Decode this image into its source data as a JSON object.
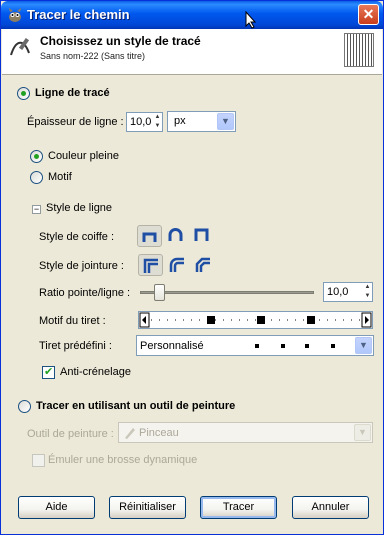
{
  "window": {
    "title": "Tracer le chemin"
  },
  "header": {
    "title": "Choisissez un style de tracé",
    "subtitle": "Sans nom-222 (Sans titre)"
  },
  "stroke_line": {
    "label": "Ligne de tracé",
    "width_label": "Épaisseur de ligne :",
    "width_value": "10,0",
    "unit": "px",
    "solid_color_label": "Couleur pleine",
    "pattern_label": "Motif",
    "line_style_label": "Style de ligne",
    "cap_label": "Style de coiffe :",
    "join_label": "Style de jointure :",
    "miter_label": "Ratio pointe/ligne :",
    "miter_value": "10,0",
    "miter_fraction": 0.1,
    "dash_label": "Motif du tiret :",
    "preset_label": "Tiret prédéfini :",
    "preset_value": "Personnalisé",
    "antialias_label": "Anti-crénelage"
  },
  "paint_tool": {
    "label": "Tracer en utilisant un outil de peinture",
    "tool_label": "Outil de peinture :",
    "tool_value": "Pinceau",
    "emulate_label": "Émuler une brosse dynamique"
  },
  "buttons": {
    "help": "Aide",
    "reset": "Réinitialiser",
    "stroke": "Tracer",
    "cancel": "Annuler"
  },
  "colors": {
    "accent": "#0054E3",
    "radio_dot": "#21A121"
  }
}
